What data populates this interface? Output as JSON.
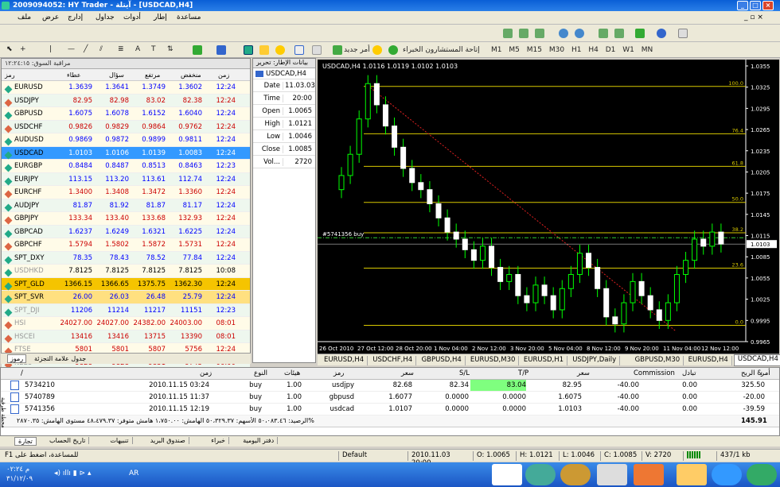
{
  "window": {
    "title": "2009094052: HY Trader - آيتلة - [USDCAD,H4]"
  },
  "menu": [
    "مساعدة",
    "إطار",
    "أدوات",
    "جداول",
    "إدارج",
    "عرض",
    "ملف"
  ],
  "toolbar1": {
    "new_order": "أمر جديد",
    "advisors": "إتاحة المستشارون الخبراء"
  },
  "timeframes": [
    "M1",
    "M5",
    "M15",
    "M30",
    "H1",
    "H4",
    "D1",
    "W1",
    "MN"
  ],
  "market_watch": {
    "header": "مراقبة السوق: ١٢:٢٤:١٥",
    "columns": [
      "رمز",
      "عطاء",
      "سؤال",
      "مرتفع",
      "منخفض",
      "زمن"
    ],
    "rows": [
      {
        "sym": "EURUSD",
        "bid": "1.3639",
        "ask": "1.3641",
        "high": "1.3749",
        "low": "1.3602",
        "time": "12:24",
        "col": "#00f"
      },
      {
        "sym": "USDJPY",
        "bid": "82.95",
        "ask": "82.98",
        "high": "83.02",
        "low": "82.38",
        "time": "12:24",
        "col": "#c00"
      },
      {
        "sym": "GBPUSD",
        "bid": "1.6075",
        "ask": "1.6078",
        "high": "1.6152",
        "low": "1.6040",
        "time": "12:24",
        "col": "#00f"
      },
      {
        "sym": "USDCHF",
        "bid": "0.9826",
        "ask": "0.9829",
        "high": "0.9864",
        "low": "0.9762",
        "time": "12:24",
        "col": "#c00"
      },
      {
        "sym": "AUDUSD",
        "bid": "0.9869",
        "ask": "0.9872",
        "high": "0.9899",
        "low": "0.9811",
        "time": "12:24",
        "col": "#00f"
      },
      {
        "sym": "USDCAD",
        "bid": "1.0103",
        "ask": "1.0106",
        "high": "1.0139",
        "low": "1.0083",
        "time": "12:24",
        "col": "#fff"
      },
      {
        "sym": "EURGBP",
        "bid": "0.8484",
        "ask": "0.8487",
        "high": "0.8513",
        "low": "0.8463",
        "time": "12:23",
        "col": "#00f"
      },
      {
        "sym": "EURJPY",
        "bid": "113.15",
        "ask": "113.20",
        "high": "113.61",
        "low": "112.74",
        "time": "12:24",
        "col": "#00f"
      },
      {
        "sym": "EURCHF",
        "bid": "1.3400",
        "ask": "1.3408",
        "high": "1.3472",
        "low": "1.3360",
        "time": "12:24",
        "col": "#c00"
      },
      {
        "sym": "AUDJPY",
        "bid": "81.87",
        "ask": "81.92",
        "high": "81.87",
        "low": "81.17",
        "time": "12:24",
        "col": "#00f"
      },
      {
        "sym": "GBPJPY",
        "bid": "133.34",
        "ask": "133.40",
        "high": "133.68",
        "low": "132.93",
        "time": "12:24",
        "col": "#c00"
      },
      {
        "sym": "GBPCAD",
        "bid": "1.6237",
        "ask": "1.6249",
        "high": "1.6321",
        "low": "1.6225",
        "time": "12:24",
        "col": "#00f"
      },
      {
        "sym": "GBPCHF",
        "bid": "1.5794",
        "ask": "1.5802",
        "high": "1.5872",
        "low": "1.5731",
        "time": "12:24",
        "col": "#c00"
      },
      {
        "sym": "SPT_DXY",
        "bid": "78.35",
        "ask": "78.43",
        "high": "78.52",
        "low": "77.84",
        "time": "12:24",
        "col": "#00f"
      },
      {
        "sym": "USDHKD",
        "bid": "7.8125",
        "ask": "7.8125",
        "high": "7.8125",
        "low": "7.8125",
        "time": "10:08",
        "col": "#000"
      },
      {
        "sym": "SPT_GLD",
        "bid": "1366.15",
        "ask": "1366.65",
        "high": "1375.75",
        "low": "1362.30",
        "time": "12:24",
        "col": "#000"
      },
      {
        "sym": "SPT_SVR",
        "bid": "26.00",
        "ask": "26.03",
        "high": "26.48",
        "low": "25.79",
        "time": "12:24",
        "col": "#00f"
      },
      {
        "sym": "SPT_DJI",
        "bid": "11206",
        "ask": "11214",
        "high": "11217",
        "low": "11151",
        "time": "12:23",
        "col": "#00f"
      },
      {
        "sym": "HSI",
        "bid": "24027.00",
        "ask": "24027.00",
        "high": "24382.00",
        "low": "24003.00",
        "time": "08:01",
        "col": "#c00"
      },
      {
        "sym": "HSCEI",
        "bid": "13416",
        "ask": "13416",
        "high": "13715",
        "low": "13390",
        "time": "08:01",
        "col": "#c00"
      },
      {
        "sym": "FTSE",
        "bid": "5801",
        "ask": "5801",
        "high": "5807",
        "low": "5756",
        "time": "12:24",
        "col": "#c00"
      },
      {
        "sym": "N225",
        "bid": "9828",
        "ask": "9828",
        "high": "9831",
        "low": "9745",
        "time": "06:00",
        "col": "#c00"
      }
    ],
    "tabs": [
      "رموز",
      "جدول علامة التجزئة"
    ]
  },
  "data_window": {
    "header": "بيانات الإطار: تحرير",
    "symbol": "USDCAD,H4",
    "rows": [
      [
        "Date",
        "11.03.03"
      ],
      [
        "Time",
        "20:00"
      ],
      [
        "Open",
        "1.0065"
      ],
      [
        "High",
        "1.0121"
      ],
      [
        "Low",
        "1.0046"
      ],
      [
        "Close",
        "1.0085"
      ],
      [
        "Vol...",
        "2720"
      ]
    ]
  },
  "chart": {
    "title": "USDCAD,H4  1.0116 1.0119 1.0102 1.0103",
    "current_price": "1.0103",
    "order_label": "#5741356 buy",
    "fib_labels": [
      [
        "100.0",
        1.0326
      ],
      [
        "76.4",
        1.0259
      ],
      [
        "61.8",
        1.0213
      ],
      [
        "50.0",
        1.0162
      ],
      [
        "38.2",
        1.0119
      ],
      [
        "23.6",
        1.0069
      ],
      [
        "0.0",
        0.9988
      ]
    ],
    "yticks": [
      "1.0355",
      "1.0325",
      "1.0295",
      "1.0265",
      "1.0235",
      "1.0205",
      "1.0175",
      "1.0145",
      "1.0115",
      "1.0085",
      "1.0055",
      "1.0025",
      "0.9995",
      "0.9965"
    ],
    "xticks": [
      "26 Oct 2010",
      "27 Oct 12:00",
      "28 Oct 20:00",
      "1 Nov 04:00",
      "2 Nov 12:00",
      "3 Nov 20:00",
      "5 Nov 04:00",
      "8 Nov 12:00",
      "9 Nov 20:00",
      "11 Nov 04:00",
      "12 Nov 12:00"
    ],
    "tabs": [
      "EURUSD,H4",
      "USDCHF,H4",
      "GBPUSD,H4",
      "EURUSD,M30",
      "EURUSD,H1",
      "USDJPY,Daily",
      "GBPUSD,M30",
      "EURUSD,H4",
      "USDCAD,H4"
    ]
  },
  "chart_data": {
    "type": "candlestick",
    "title": "USDCAD,H4  1.0116 1.0119 1.0102 1.0103",
    "ylim": [
      0.9965,
      1.0355
    ],
    "x": [
      "26 Oct 2010",
      "27 Oct 12:00",
      "28 Oct 20:00",
      "1 Nov 04:00",
      "2 Nov 12:00",
      "3 Nov 20:00",
      "5 Nov 04:00",
      "8 Nov 12:00",
      "9 Nov 20:00",
      "11 Nov 04:00",
      "12 Nov 12:00"
    ],
    "closes": [
      1.02,
      1.023,
      1.028,
      1.033,
      1.03,
      1.027,
      1.024,
      1.021,
      1.019,
      1.018,
      1.016,
      1.014,
      1.012,
      1.011,
      1.0095,
      1.008,
      1.01,
      1.007,
      1.005,
      1.006,
      1.003,
      1.002,
      1.0045,
      1.003,
      1.001,
      1.004,
      1.006,
      1.009,
      1.007,
      1.004,
      1.0,
      0.999,
      1.002,
      1.005,
      1.003,
      1.001,
      0.9995,
      1.002,
      1.006,
      1.008,
      1.011,
      1.01,
      1.012,
      1.0103
    ]
  },
  "terminal": {
    "columns": [
      "أمر",
      "/",
      "زمن",
      "النوع",
      "هيئات",
      "رمز",
      "سعر",
      "S/L",
      "T/P",
      "سعر",
      "Commission",
      "تبادل",
      "الربح &"
    ],
    "rows": [
      [
        "5734210",
        "2010.11.15 03:24",
        "buy",
        "1.00",
        "usdjpy",
        "82.68",
        "82.34",
        "83.04",
        "82.95",
        "-40.00",
        "0.00",
        "325.50"
      ],
      [
        "5740789",
        "2010.11.15 11:37",
        "buy",
        "1.00",
        "gbpusd",
        "1.6077",
        "0.0000",
        "0.0000",
        "1.6075",
        "-40.00",
        "0.00",
        "-20.00"
      ],
      [
        "5741356",
        "2010.11.15 12:19",
        "buy",
        "1.00",
        "usdcad",
        "1.0107",
        "0.0000",
        "0.0000",
        "1.0103",
        "-40.00",
        "0.00",
        "-39.59"
      ]
    ],
    "summary": "الرصيد: ٥٠،٠٨٣.٤٦  الأسهم: ٥٠،٣٢٩.٣٧  الهامش: ١،٧٥٠.٠٠  هامش متوفر: ٤٨،٤٧٩.٣٧  مستوى الهامش: ٢٨٧٠.٣٥%",
    "total": "145.91",
    "tabs": [
      "تجارة",
      "تاريخ الحساب",
      "تنبيهات",
      "صندوق البريد",
      "خبراء",
      "دفتر اليومية"
    ],
    "side_label": "محطة طرفية"
  },
  "status": {
    "help": "F1 للمساعدة، اضغط على",
    "profile": "Default",
    "date": "2010.11.03 20:00",
    "o": "O: 1.0065",
    "h": "H: 1.0121",
    "l": "L: 1.0046",
    "c": "C: 1.0085",
    "v": "V: 2720",
    "kb": "437/1 kb"
  },
  "taskbar": {
    "time": "م ٠٢:٢٤",
    "date": "٣١/١٢/٠٩",
    "lang": "AR"
  }
}
